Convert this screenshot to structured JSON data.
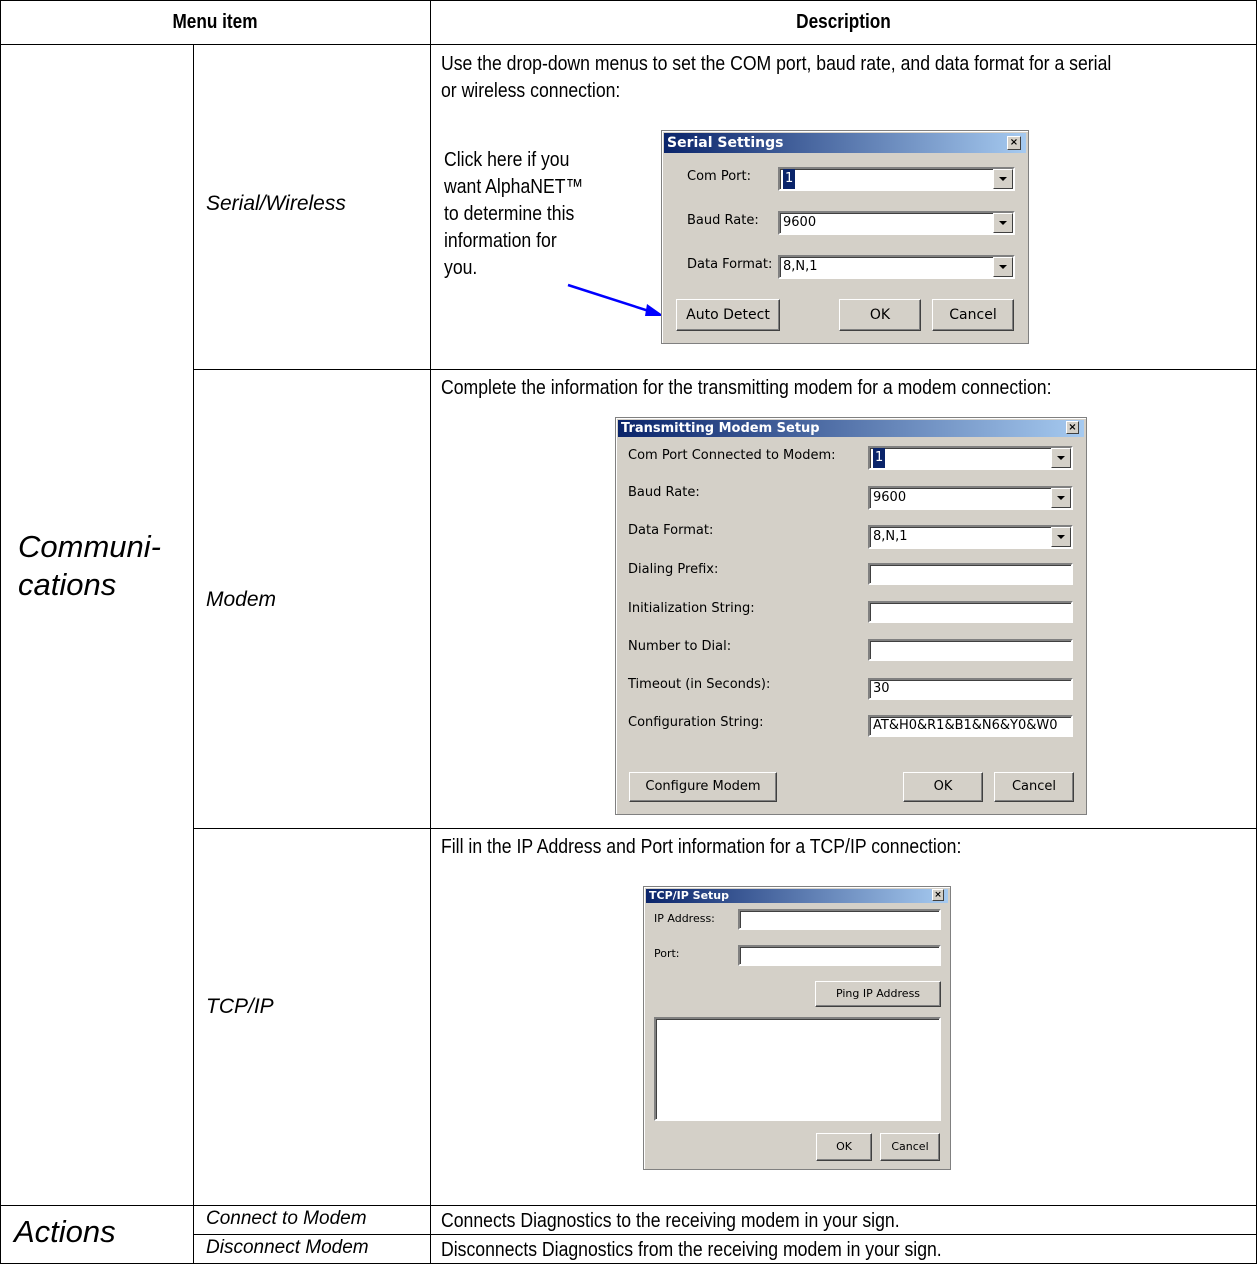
{
  "header": {
    "col1": "Menu item",
    "col2": "Description"
  },
  "communications": {
    "label": "Communi-\ncations",
    "serial": {
      "name": "Serial/Wireless",
      "desc": "Use the drop-down menus to set the COM port, baud rate, and data format for a serial\nor wireless connection:",
      "callout": "Click here if you\nwant AlphaNET™\nto determine this\ninformation for\nyou.",
      "dialog": {
        "title": "Serial Settings",
        "com_port_label": "Com Port:",
        "com_port_value": "1",
        "baud_label": "Baud Rate:",
        "baud_value": "9600",
        "format_label": "Data Format:",
        "format_value": "8,N,1",
        "auto_detect": "Auto Detect",
        "ok": "OK",
        "cancel": "Cancel"
      }
    },
    "modem": {
      "name": "Modem",
      "desc": "Complete the information for the transmitting modem for a modem connection:",
      "dialog": {
        "title": "Transmitting Modem Setup",
        "com_port_label": "Com Port Connected to Modem:",
        "com_port_value": "1",
        "baud_label": "Baud Rate:",
        "baud_value": "9600",
        "format_label": "Data Format:",
        "format_value": "8,N,1",
        "prefix_label": "Dialing Prefix:",
        "prefix_value": "",
        "init_label": "Initialization String:",
        "init_value": "",
        "number_label": "Number to Dial:",
        "number_value": "",
        "timeout_label": "Timeout (in Seconds):",
        "timeout_value": "30",
        "config_label": "Configuration String:",
        "config_value": "AT&H0&R1&B1&N6&Y0&W0",
        "configure": "Configure Modem",
        "ok": "OK",
        "cancel": "Cancel"
      }
    },
    "tcpip": {
      "name": "TCP/IP",
      "desc": "Fill in the IP Address and Port information for a TCP/IP connection:",
      "dialog": {
        "title": "TCP/IP Setup",
        "ip_label": "IP Address:",
        "ip_value": "",
        "port_label": "Port:",
        "port_value": "",
        "ping": "Ping IP Address",
        "ok": "OK",
        "cancel": "Cancel"
      }
    }
  },
  "actions": {
    "label": "Actions",
    "rows": [
      {
        "name": "Connect to Modem",
        "desc": "Connects Diagnostics to the receiving modem in your sign."
      },
      {
        "name": "Disconnect Modem",
        "desc": "Disconnects Diagnostics from the receiving modem in your sign."
      }
    ]
  },
  "colors": {
    "title_dark": "#0a246a",
    "title_light": "#a6caf0",
    "dialog_bg": "#d4d0c8",
    "arrow": "#0000ff"
  }
}
